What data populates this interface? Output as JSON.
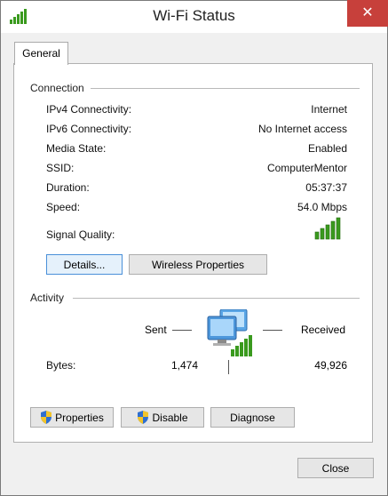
{
  "window": {
    "title": "Wi-Fi Status",
    "close_glyph": "✕"
  },
  "tabs": [
    {
      "label": "General"
    }
  ],
  "connection": {
    "heading": "Connection",
    "rows": [
      {
        "label": "IPv4 Connectivity:",
        "value": "Internet"
      },
      {
        "label": "IPv6 Connectivity:",
        "value": "No Internet access"
      },
      {
        "label": "Media State:",
        "value": "Enabled"
      },
      {
        "label": "SSID:",
        "value": "ComputerMentor"
      },
      {
        "label": "Duration:",
        "value": "05:37:37"
      },
      {
        "label": "Speed:",
        "value": "54.0 Mbps"
      }
    ],
    "signal_label": "Signal Quality:",
    "signal_bars_lit": 5,
    "signal_bars_total": 5,
    "details_button": "Details...",
    "wireless_button": "Wireless Properties"
  },
  "activity": {
    "heading": "Activity",
    "sent_label": "Sent",
    "received_label": "Received",
    "bytes_label": "Bytes:",
    "bytes_sent": "1,474",
    "bytes_received": "49,926"
  },
  "actions": {
    "properties_label": "Properties",
    "disable_label": "Disable",
    "diagnose_label": "Diagnose"
  },
  "footer": {
    "close_label": "Close"
  },
  "icons": {
    "title": "wifi-signal-icon",
    "signal": "signal-bars-icon",
    "network": "network-computers-icon",
    "shield": "uac-shield-icon"
  },
  "colors": {
    "signal_green": "#3a9a1e",
    "close_red": "#c7403b",
    "focus_blue": "#4a90d9"
  }
}
